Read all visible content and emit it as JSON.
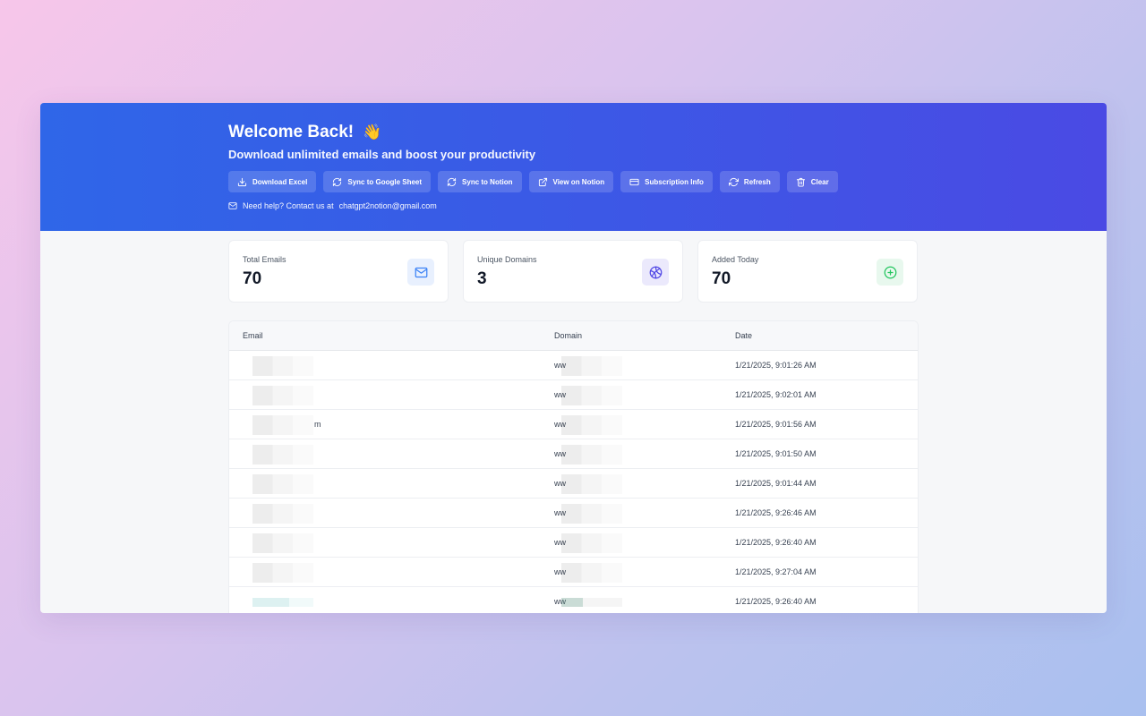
{
  "header": {
    "title": "Welcome Back!",
    "wave_emoji": "👋",
    "subtitle": "Download unlimited emails and boost your productivity",
    "actions": [
      {
        "label": "Download Excel",
        "icon": "download-icon"
      },
      {
        "label": "Sync to Google Sheet",
        "icon": "sync-icon"
      },
      {
        "label": "Sync to Notion",
        "icon": "sync-icon"
      },
      {
        "label": "View on Notion",
        "icon": "external-link-icon"
      },
      {
        "label": "Subscription Info",
        "icon": "credit-card-icon"
      },
      {
        "label": "Refresh",
        "icon": "refresh-icon"
      },
      {
        "label": "Clear",
        "icon": "trash-icon"
      }
    ],
    "help_prefix": "Need help? Contact us at",
    "help_email": "chatgpt2notion@gmail.com"
  },
  "stats": [
    {
      "label": "Total Emails",
      "value": "70",
      "icon": "mail-icon",
      "color": "#3b82f6",
      "bg": "#e8f0fe"
    },
    {
      "label": "Unique Domains",
      "value": "3",
      "icon": "globe-icon",
      "color": "#4f46e5",
      "bg": "#ebe9fc"
    },
    {
      "label": "Added Today",
      "value": "70",
      "icon": "plus-circle-icon",
      "color": "#22c55e",
      "bg": "#e8f8ee"
    }
  ],
  "table": {
    "columns": [
      "Email",
      "Domain",
      "Date"
    ],
    "rows": [
      {
        "email": "",
        "domain": "ww",
        "date": "1/21/2025, 9:01:26 AM"
      },
      {
        "email": "",
        "domain": "ww",
        "date": "1/21/2025, 9:02:01 AM"
      },
      {
        "email": "m",
        "domain": "ww",
        "date": "1/21/2025, 9:01:56 AM"
      },
      {
        "email": "",
        "domain": "ww",
        "date": "1/21/2025, 9:01:50 AM"
      },
      {
        "email": "",
        "domain": "ww",
        "date": "1/21/2025, 9:01:44 AM"
      },
      {
        "email": "",
        "domain": "ww",
        "date": "1/21/2025, 9:26:46 AM"
      },
      {
        "email": "",
        "domain": "ww",
        "date": "1/21/2025, 9:26:40 AM"
      },
      {
        "email": "",
        "domain": "ww",
        "date": "1/21/2025, 9:27:04 AM"
      },
      {
        "email": "",
        "domain": "ww",
        "date": "1/21/2025, 9:26:40 AM"
      }
    ]
  }
}
